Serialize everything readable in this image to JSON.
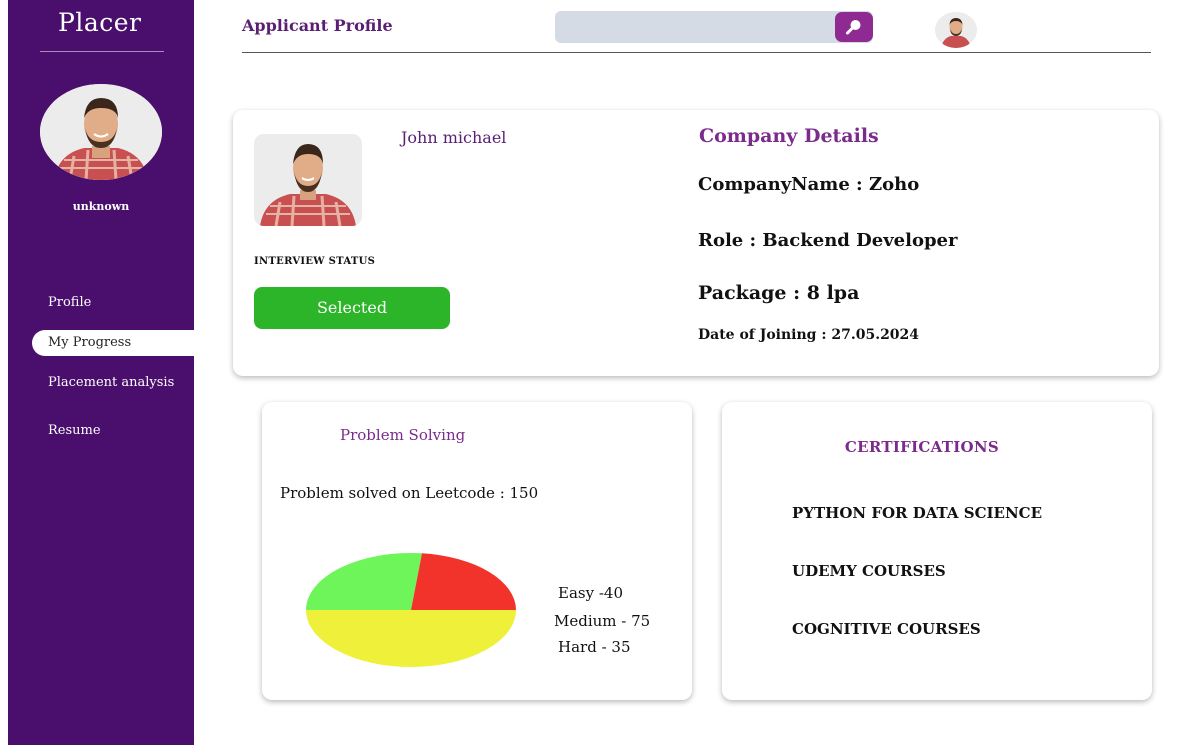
{
  "app": {
    "brand": "Placer"
  },
  "sidebar": {
    "username": "unknown",
    "items": [
      {
        "label": "Profile"
      },
      {
        "label": "My Progress",
        "active": true
      },
      {
        "label": "Placement analysis"
      },
      {
        "label": "Resume"
      }
    ]
  },
  "header": {
    "title": "Applicant Profile",
    "search_placeholder": "",
    "search_icon": "search-icon"
  },
  "profile": {
    "name": "John michael",
    "interview_status_label": "INTERVIEW STATUS",
    "status": "Selected"
  },
  "company": {
    "heading": "Company Details",
    "name_line": "CompanyName :  Zoho",
    "role_line": "Role :  Backend Developer",
    "package_line": "Package   : 8 lpa",
    "doj_line": "Date of  Joining : 27.05.2024"
  },
  "problem_solving": {
    "heading": "Problem Solving",
    "solved_line": "Problem solved  on Leetcode  : 150",
    "legend": {
      "easy": "Easy -40",
      "medium": "Medium - 75",
      "hard": "Hard - 35"
    }
  },
  "chart_data": {
    "type": "pie",
    "categories": [
      "Easy",
      "Medium",
      "Hard"
    ],
    "values": [
      40,
      75,
      35
    ],
    "colors": [
      "#6ef55a",
      "#eef03a",
      "#f2332b"
    ]
  },
  "certifications": {
    "heading": "CERTIFICATIONS",
    "items": [
      "PYTHON FOR DATA SCIENCE",
      "UDEMY COURSES",
      "COGNITIVE  COURSES"
    ]
  },
  "colors": {
    "sidebar": "#4a0f6c",
    "accent": "#7a2b8c",
    "status_green": "#2db52a",
    "search_button": "#8e2a92"
  }
}
